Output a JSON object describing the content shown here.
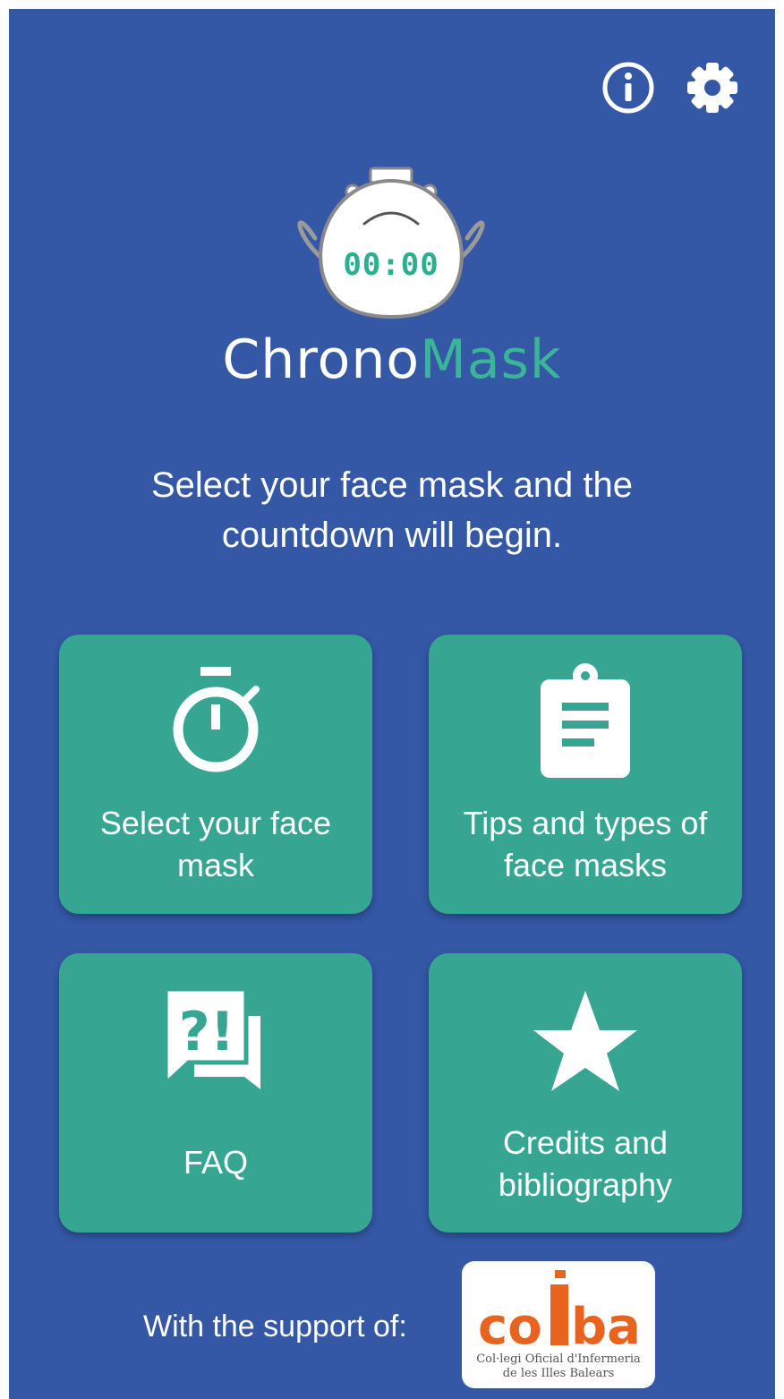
{
  "app": {
    "name_part1": "Chrono",
    "name_part2": "Mask",
    "logo_timer": "00:00"
  },
  "header": {
    "info_icon": "info-circle-icon",
    "settings_icon": "gear-icon"
  },
  "intro": {
    "text": "Select your face mask and the countdown will begin."
  },
  "tiles": [
    {
      "label": "Select your face mask",
      "icon": "stopwatch-icon"
    },
    {
      "label": "Tips and types of face masks",
      "icon": "clipboard-icon"
    },
    {
      "label": "FAQ",
      "icon": "faq-chat-icon"
    },
    {
      "label": "Credits and bibliography",
      "icon": "star-icon"
    }
  ],
  "footer": {
    "support_text": "With the support of:",
    "sponsor": {
      "name": "coiba",
      "line1": "Col·legi Oficial d'Infermeria",
      "line2": "de les Illes Balears"
    }
  },
  "colors": {
    "background": "#3457a6",
    "tile": "#36a692",
    "accent": "#3bb59a",
    "sponsor_orange": "#e8631d"
  }
}
